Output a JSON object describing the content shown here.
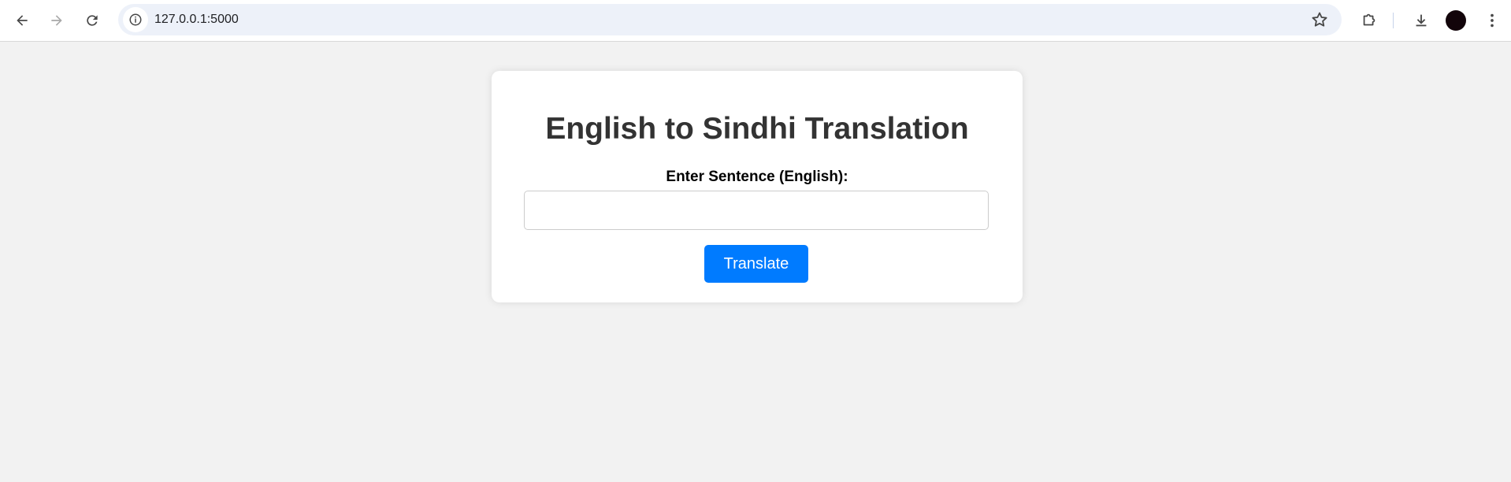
{
  "browser": {
    "url": "127.0.0.1:5000",
    "icons": {
      "back": "arrow-left-icon",
      "forward": "arrow-right-icon",
      "reload": "reload-icon",
      "site_info": "info-icon",
      "bookmark": "star-icon",
      "extensions": "puzzle-icon",
      "downloads": "download-icon",
      "menu": "kebab-menu-icon"
    },
    "colors": {
      "omnibox_bg": "#edf1f9",
      "avatar": "#12040a"
    }
  },
  "page": {
    "title": "English to Sindhi Translation",
    "input_label": "Enter Sentence (English):",
    "input_value": "",
    "input_placeholder": "",
    "submit_label": "Translate",
    "colors": {
      "background": "#f2f2f2",
      "card": "#ffffff",
      "heading": "#333333",
      "accent": "#007bff"
    }
  }
}
